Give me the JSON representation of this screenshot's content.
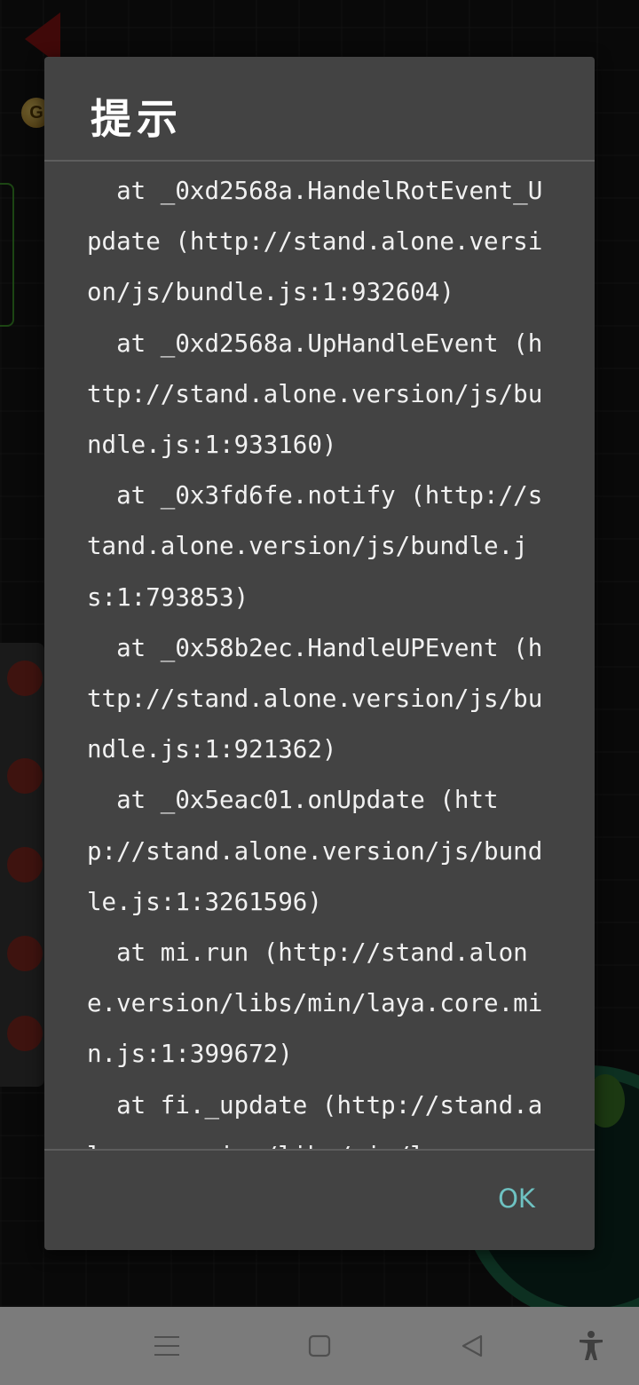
{
  "dialog": {
    "title": "提示",
    "message_lines": [
      "  at _0xd2568a.HandelRotEvent_Update (http://stand.alone.version/js/bundle.js:1:932604)",
      "  at _0xd2568a.UpHandleEvent (http://stand.alone.version/js/bundle.js:1:933160)",
      "  at _0x3fd6fe.notify (http://stand.alone.version/js/bundle.js:1:793853)",
      "  at _0x58b2ec.HandleUPEvent (http://stand.alone.version/js/bundle.js:1:921362)",
      "  at _0x5eac01.onUpdate (http://stand.alone.version/js/bundle.js:1:3261596)",
      "  at mi.run (http://stand.alone.version/libs/min/laya.core.min.js:1:399672)",
      "  at fi._update (http://stand.alone.version/libs/min/laya.core.min.js"
    ],
    "ok_label": "OK",
    "ok_color": "#6ec2c2",
    "background_color": "#434343"
  },
  "background": {
    "coin_glyph": "G"
  },
  "nav_bar": {
    "buttons": [
      {
        "name": "menu-button",
        "icon": "menu-icon"
      },
      {
        "name": "home-button",
        "icon": "square-icon"
      },
      {
        "name": "back-button",
        "icon": "back-triangle-icon"
      },
      {
        "name": "accessibility-button",
        "icon": "accessibility-icon"
      }
    ],
    "background_color": "#7b7b7b"
  }
}
